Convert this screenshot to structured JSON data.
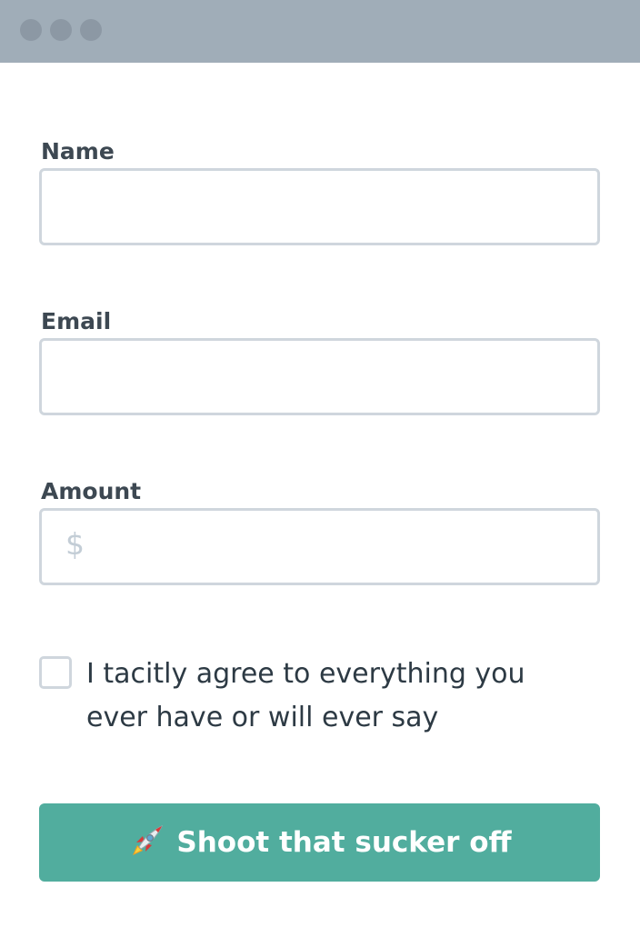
{
  "form": {
    "name_label": "Name",
    "name_value": "",
    "email_label": "Email",
    "email_value": "",
    "amount_label": "Amount",
    "amount_prefix": "$",
    "amount_value": "",
    "agree_line1": "I tacitly agree to everything you",
    "agree_line2": "ever have or will ever say",
    "agree_checked": false,
    "submit_label": "Shoot that sucker off",
    "submit_icon": "rocket-icon"
  },
  "colors": {
    "titlebar": "#a0adb8",
    "button": "#51ad9e",
    "label": "#3d4852",
    "border": "#cfd6dd"
  }
}
